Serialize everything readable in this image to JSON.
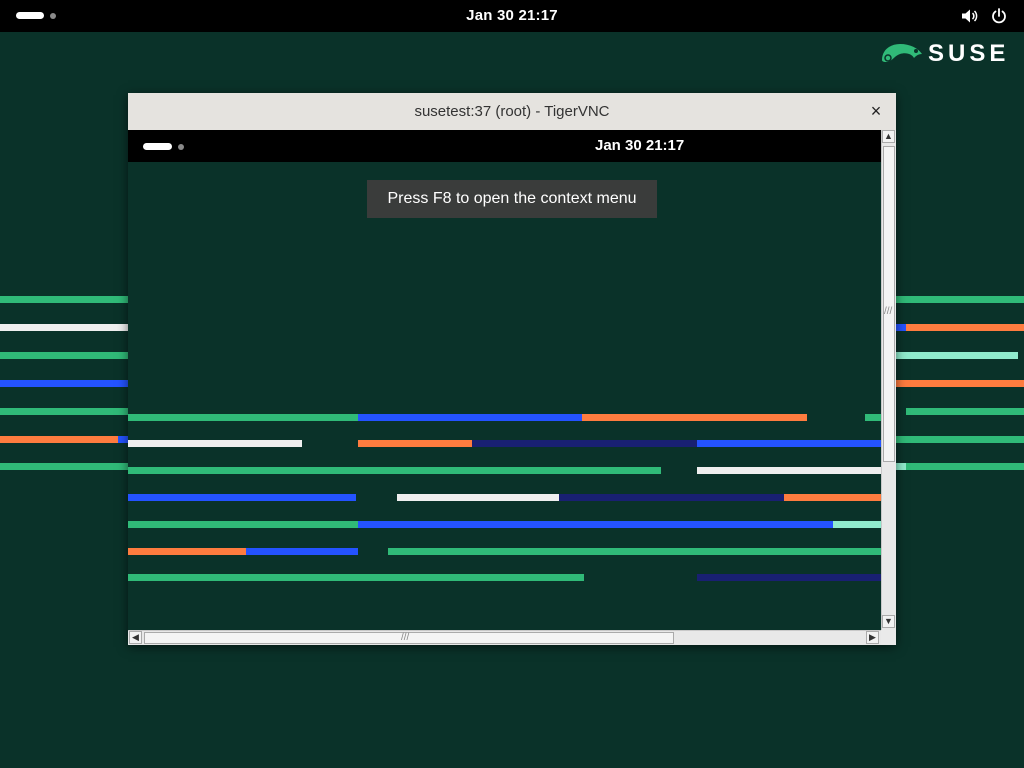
{
  "top_bar": {
    "clock": "Jan 30  21:17",
    "tray_icons": [
      "volume-icon",
      "power-icon"
    ]
  },
  "brand": {
    "logo_text": "SUSE",
    "logo_icon": "chameleon-icon",
    "color": "#30ba78"
  },
  "window": {
    "title": "susetest:37 (root) - TigerVNC",
    "close_glyph": "×",
    "remote_top_bar": {
      "clock": "Jan 30  21:17"
    },
    "notice": "Press F8 to open the context menu",
    "scroll_glyphs": {
      "up": "▲",
      "down": "▼",
      "left": "◀",
      "right": "▶",
      "grip": "///"
    }
  },
  "stripe_colors": {
    "green": "#30ba78",
    "white": "#efefef",
    "blue": "#2453ff",
    "orange": "#fe7c3f",
    "navy": "#192072",
    "mint": "#90ebcd"
  }
}
